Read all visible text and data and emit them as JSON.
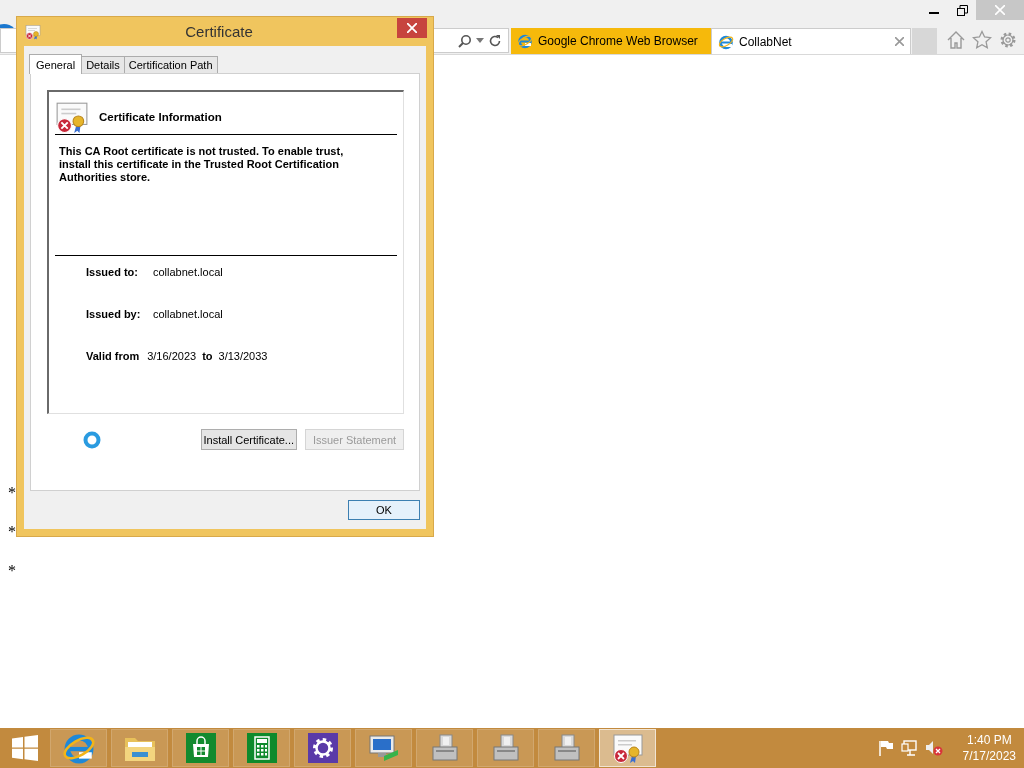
{
  "browser": {
    "tabs": [
      {
        "label": "Google Chrome Web Browser",
        "selected": false
      },
      {
        "label": "CollabNet",
        "selected": true
      }
    ],
    "page": [
      {
        "kind": "bullet",
        "text": "*"
      },
      {
        "kind": "bullet",
        "text": "*"
      },
      {
        "kind": "bullet",
        "text": "*"
      }
    ]
  },
  "dialog": {
    "title": "Certificate",
    "tabs": [
      {
        "label": "General",
        "selected": true
      },
      {
        "label": "Details",
        "selected": false
      },
      {
        "label": "Certification Path",
        "selected": false
      }
    ],
    "info_title": "Certificate Information",
    "message": "This CA Root certificate is not trusted. To enable trust, install this certificate in the Trusted Root Certification Authorities store.",
    "fields": [
      {
        "label": "Issued to:",
        "value": "collabnet.local"
      },
      {
        "label": "Issued by:",
        "value": "collabnet.local"
      }
    ],
    "validity": {
      "label": "Valid from",
      "from": "3/16/2023",
      "to_label": "to",
      "to": "3/13/2033"
    },
    "buttons": [
      {
        "label": "Install Certificate...",
        "disabled": false
      },
      {
        "label": "Issuer Statement",
        "disabled": true
      }
    ],
    "ok": "OK"
  },
  "taskbar": {
    "items": [
      {
        "kind": "browser",
        "active": false
      },
      {
        "kind": "folder",
        "active": false
      },
      {
        "kind": "store",
        "active": false
      },
      {
        "kind": "calculator",
        "active": false
      },
      {
        "kind": "settings",
        "active": false
      },
      {
        "kind": "network",
        "active": false
      },
      {
        "kind": "server",
        "active": false
      },
      {
        "kind": "server",
        "active": false
      },
      {
        "kind": "server",
        "active": false
      },
      {
        "kind": "certificate",
        "active": true
      }
    ],
    "clock": {
      "time": "1:40 PM",
      "date": "7/17/2023"
    }
  }
}
